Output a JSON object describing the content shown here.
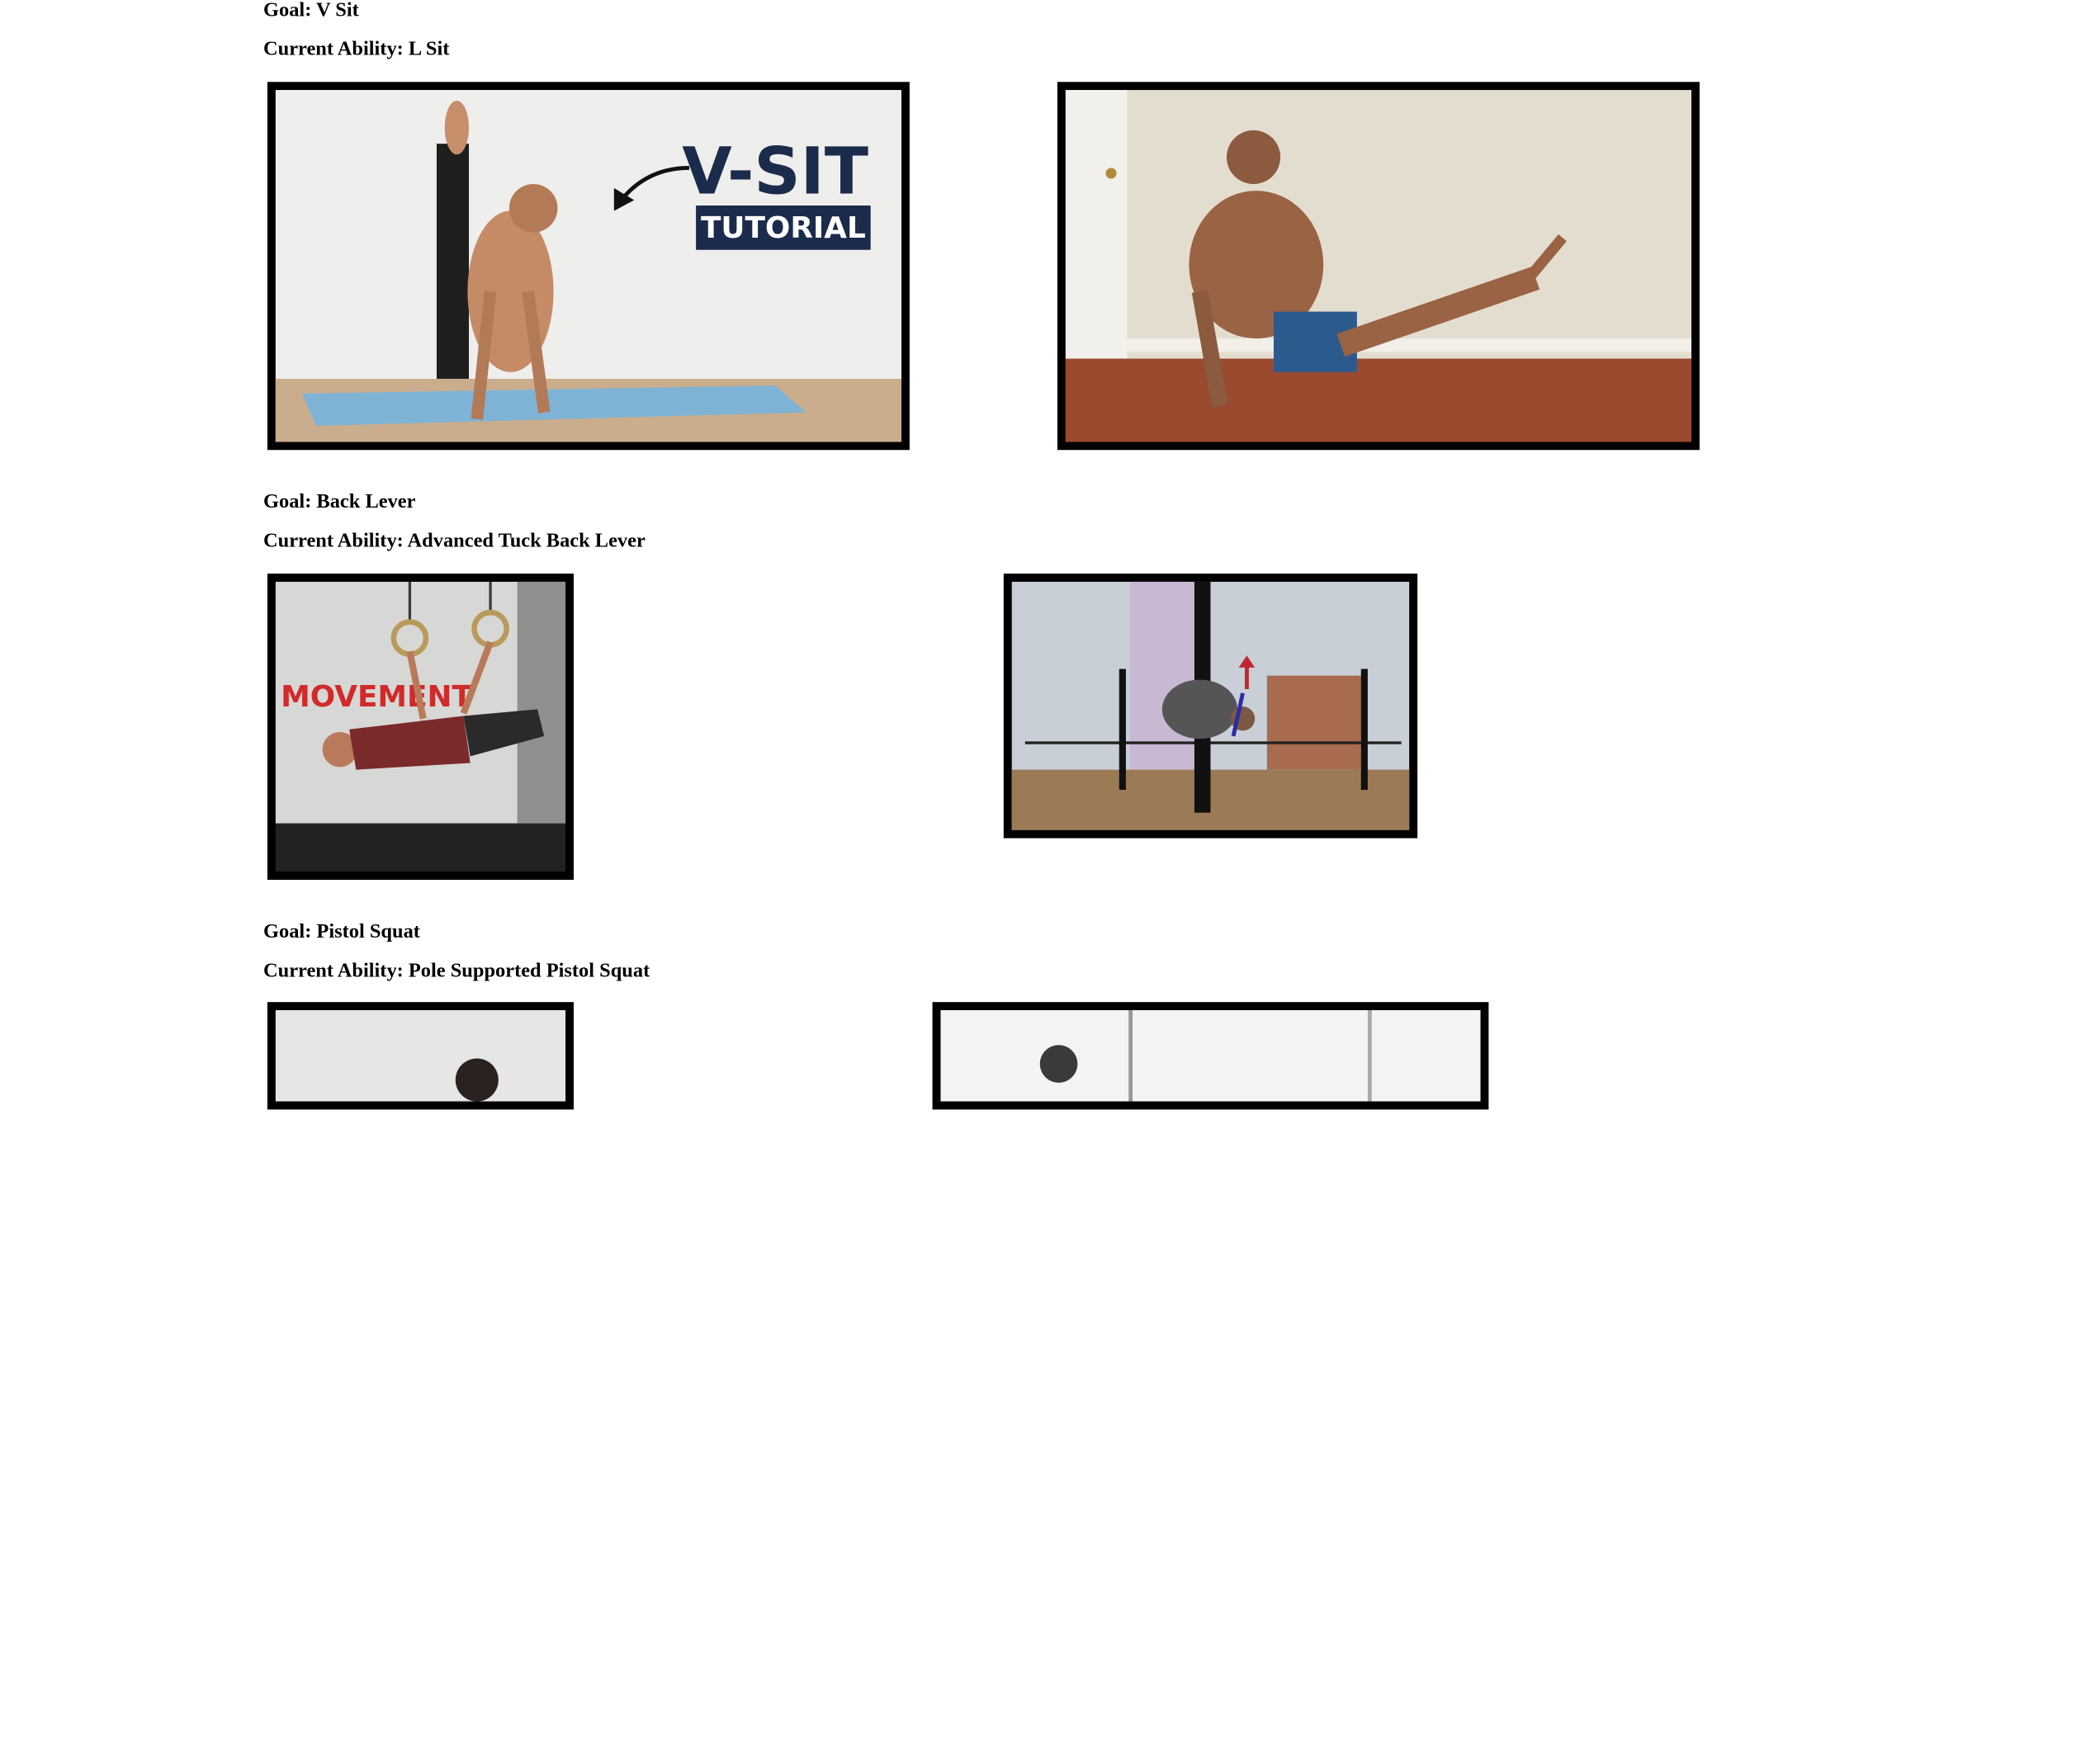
{
  "sections": [
    {
      "goal_text": "Goal: V Sit",
      "ability_text": "Current Ability: L Sit",
      "goal_image": {
        "subject": "man holding v-sit on yoga mat",
        "overlay_title": "V-SIT",
        "overlay_subtitle": "TUTORIAL"
      },
      "ability_image": {
        "subject": "man holding l-sit on wooden floor"
      }
    },
    {
      "goal_text": "Goal: Back Lever",
      "ability_text": "Current Ability: Advanced Tuck Back Lever",
      "goal_image": {
        "subject": "man doing back lever on gymnastic rings",
        "wall_text": "MOVEMENT"
      },
      "ability_image": {
        "subject": "man doing tuck back lever on outdoor bar"
      }
    },
    {
      "goal_text": "Goal: Pistol Squat",
      "ability_text": "Current Ability: Pole Supported Pistol Squat",
      "goal_image": {
        "subject": "man doing pistol squat"
      },
      "ability_image": {
        "subject": "man doing pole supported pistol squat, black and white"
      }
    }
  ],
  "colors": {
    "background": "#ffffff",
    "text": "#000000",
    "frame": "#000000",
    "vsit_title": "#1b2b4b"
  }
}
